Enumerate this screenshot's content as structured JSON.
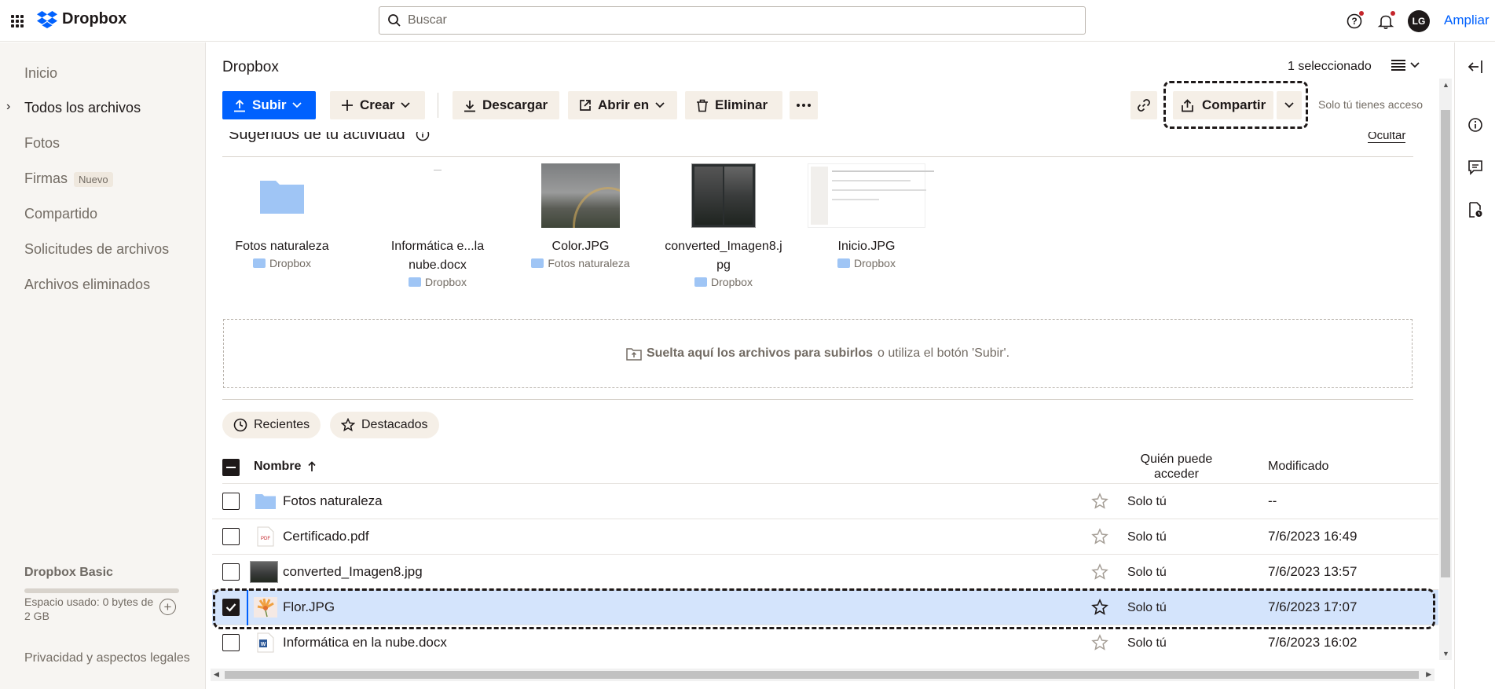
{
  "app": {
    "logo_text": "Dropbox",
    "accent": "#0061fe"
  },
  "search": {
    "placeholder": "Buscar"
  },
  "user": {
    "initials": "LG",
    "upgrade_label": "Ampliar"
  },
  "sidebar": {
    "items": [
      {
        "label": "Inicio"
      },
      {
        "label": "Todos los archivos",
        "active": true
      },
      {
        "label": "Fotos"
      },
      {
        "label": "Firmas",
        "badge": "Nuevo"
      },
      {
        "label": "Compartido"
      },
      {
        "label": "Solicitudes de archivos"
      },
      {
        "label": "Archivos eliminados"
      }
    ],
    "plan": "Dropbox Basic",
    "usage": "Espacio usado: 0 bytes de 2 GB",
    "privacy": "Privacidad y aspectos legales"
  },
  "header": {
    "breadcrumb": "Dropbox",
    "selected_count": "1 seleccionado"
  },
  "toolbar": {
    "upload": "Subir",
    "create": "Crear",
    "download": "Descargar",
    "open_in": "Abrir en",
    "delete": "Eliminar",
    "share": "Compartir",
    "access_note": "Solo tú tienes acceso"
  },
  "suggested": {
    "title": "Sugeridos de tu actividad",
    "hide": "Ocultar",
    "items": [
      {
        "name": "Fotos naturaleza",
        "location": "Dropbox",
        "kind": "folder"
      },
      {
        "name": "Informática e...la nube.docx",
        "location": "Dropbox",
        "kind": "doc"
      },
      {
        "name": "Color.JPG",
        "location": "Fotos naturaleza",
        "kind": "image"
      },
      {
        "name": "converted_Imagen8.jpg",
        "location": "Dropbox",
        "kind": "image"
      },
      {
        "name": "Inicio.JPG",
        "location": "Dropbox",
        "kind": "screenshot"
      }
    ]
  },
  "dropzone": {
    "bold": "Suelta aquí los archivos para subirlos",
    "rest": "o utiliza el botón 'Subir'."
  },
  "filters": {
    "recent": "Recientes",
    "starred": "Destacados"
  },
  "table": {
    "columns": {
      "name": "Nombre",
      "who": "Quién puede acceder",
      "modified": "Modificado"
    },
    "rows": [
      {
        "name": "Fotos naturaleza",
        "who": "Solo tú",
        "modified": "--",
        "icon": "folder-icon",
        "selected": false
      },
      {
        "name": "Certificado.pdf",
        "who": "Solo tú",
        "modified": "7/6/2023 16:49",
        "icon": "pdf-icon",
        "selected": false
      },
      {
        "name": "converted_Imagen8.jpg",
        "who": "Solo tú",
        "modified": "7/6/2023 13:57",
        "icon": "image-thumb-icon",
        "selected": false
      },
      {
        "name": "Flor.JPG",
        "who": "Solo tú",
        "modified": "7/6/2023 17:07",
        "icon": "flower-thumb-icon",
        "selected": true
      },
      {
        "name": "Informática en la nube.docx",
        "who": "Solo tú",
        "modified": "7/6/2023 16:02",
        "icon": "word-icon",
        "selected": false
      }
    ]
  }
}
